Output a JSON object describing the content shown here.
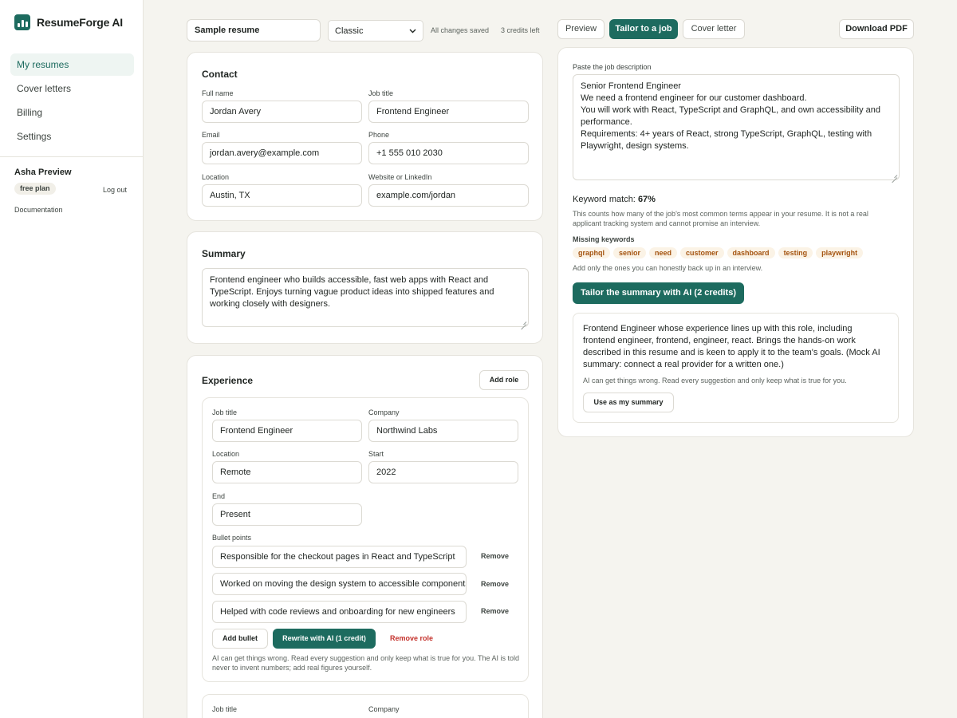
{
  "app": {
    "name": "ResumeForge AI"
  },
  "sidebar": {
    "items": [
      {
        "label": "My resumes",
        "active": true
      },
      {
        "label": "Cover letters"
      },
      {
        "label": "Billing"
      },
      {
        "label": "Settings"
      }
    ],
    "user": {
      "name": "Asha Preview",
      "plan": "free plan",
      "logout": "Log out"
    },
    "docs": "Documentation"
  },
  "topbar": {
    "resume_name": "Sample resume",
    "template": "Classic",
    "save_status": "All changes saved",
    "credits": "3 credits left",
    "tabs": [
      "Preview",
      "Tailor to a job",
      "Cover letter"
    ],
    "active_tab": "Tailor to a job",
    "download": "Download PDF"
  },
  "contact": {
    "title": "Contact",
    "fields": {
      "full_name": {
        "label": "Full name",
        "value": "Jordan Avery"
      },
      "job_title": {
        "label": "Job title",
        "value": "Frontend Engineer"
      },
      "email": {
        "label": "Email",
        "value": "jordan.avery@example.com"
      },
      "phone": {
        "label": "Phone",
        "value": "+1 555 010 2030"
      },
      "location": {
        "label": "Location",
        "value": "Austin, TX"
      },
      "website": {
        "label": "Website or LinkedIn",
        "value": "example.com/jordan"
      }
    }
  },
  "summary": {
    "title": "Summary",
    "text": "Frontend engineer who builds accessible, fast web apps with React and TypeScript. Enjoys turning vague product ideas into shipped features and working closely with designers."
  },
  "experience": {
    "title": "Experience",
    "add_role": "Add role",
    "roles": [
      {
        "job_title_label": "Job title",
        "job_title": "Frontend Engineer",
        "company_label": "Company",
        "company": "Northwind Labs",
        "location_label": "Location",
        "location": "Remote",
        "start_label": "Start",
        "start": "2022",
        "end_label": "End",
        "end": "Present",
        "bullets_label": "Bullet points",
        "bullets": [
          "Responsible for the checkout pages in React and TypeScript",
          "Worked on moving the design system to accessible components",
          "Helped with code reviews and onboarding for new engineers"
        ],
        "remove": "Remove",
        "add_bullet": "Add bullet",
        "rewrite": "Rewrite with AI (1 credit)",
        "remove_role": "Remove role",
        "note": "AI can get things wrong. Read every suggestion and only keep what is true for you. The AI is told never to invent numbers; add real figures yourself."
      },
      {
        "job_title_label": "Job title",
        "company_label": "Company"
      }
    ]
  },
  "tailor": {
    "jd_label": "Paste the job description",
    "jd_text": "Senior Frontend Engineer\nWe need a frontend engineer for our customer dashboard.\nYou will work with React, TypeScript and GraphQL, and own accessibility and performance.\nRequirements: 4+ years of React, strong TypeScript, GraphQL, testing with Playwright, design systems.",
    "match_label": "Keyword match:",
    "match_value": "67%",
    "match_note": "This counts how many of the job's most common terms appear in your resume. It is not a real applicant tracking system and cannot promise an interview.",
    "missing_label": "Missing keywords",
    "missing": [
      "graphql",
      "senior",
      "need",
      "customer",
      "dashboard",
      "testing",
      "playwright"
    ],
    "missing_note": "Add only the ones you can honestly back up in an interview.",
    "tailor_btn": "Tailor the summary with AI (2 credits)",
    "ai_summary": "Frontend Engineer whose experience lines up with this role, including frontend engineer, frontend, engineer, react. Brings the hands-on work described in this resume and is keen to apply it to the team's goals. (Mock AI summary: connect a real provider for a written one.)",
    "ai_note": "AI can get things wrong. Read every suggestion and only keep what is true for you.",
    "use_btn": "Use as my summary"
  },
  "colors": {
    "accent": "#1d6b5f",
    "danger": "#c4322c",
    "chip_text": "#a4530f",
    "chip_bg": "#fbf3e6"
  }
}
